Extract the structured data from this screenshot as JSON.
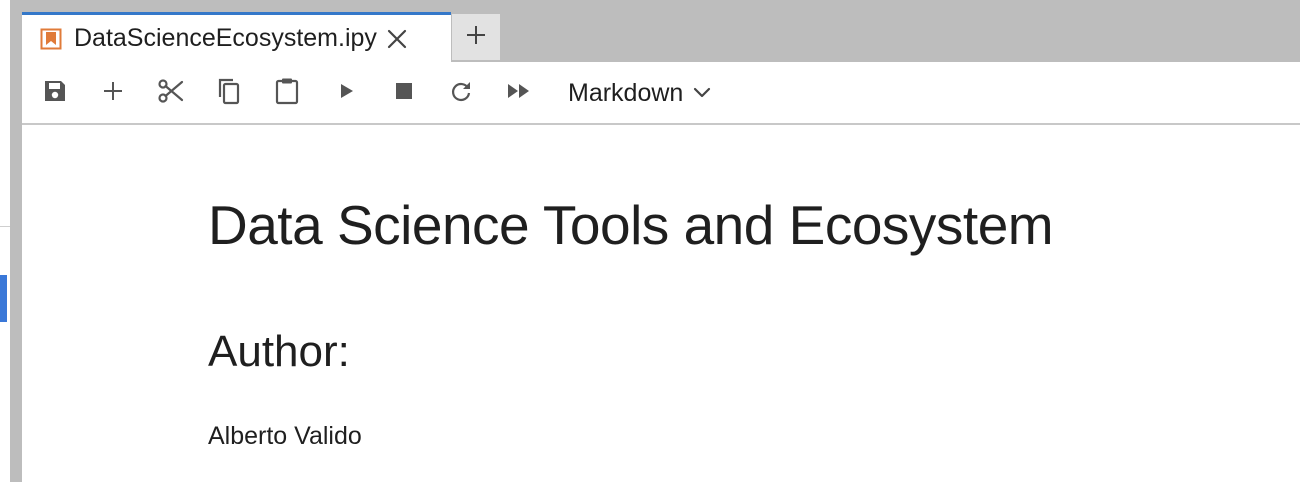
{
  "tab": {
    "title": "DataScienceEcosystem.ipy",
    "icon": "notebook-bookmark-icon",
    "icon_color": "#e07b39",
    "accent_color": "#3478c9"
  },
  "new_tab": {
    "icon": "plus-icon"
  },
  "toolbar": {
    "buttons": [
      {
        "name": "save",
        "icon": "save-icon"
      },
      {
        "name": "insert-cell",
        "icon": "plus-icon"
      },
      {
        "name": "cut",
        "icon": "scissors-icon"
      },
      {
        "name": "copy",
        "icon": "copy-icon"
      },
      {
        "name": "paste",
        "icon": "clipboard-icon"
      },
      {
        "name": "run",
        "icon": "play-icon"
      },
      {
        "name": "interrupt",
        "icon": "stop-icon"
      },
      {
        "name": "restart",
        "icon": "refresh-icon"
      },
      {
        "name": "restart-run-all",
        "icon": "fast-forward-icon"
      }
    ],
    "cell_type": "Markdown"
  },
  "notebook": {
    "heading1": "Data Science Tools and Ecosystem",
    "heading2": "Author:",
    "paragraph": "Alberto Valido"
  }
}
